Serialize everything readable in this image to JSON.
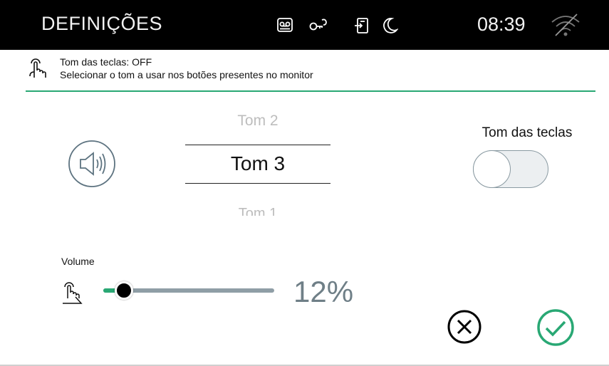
{
  "topbar": {
    "title": "DEFINIÇÕES",
    "time": "08:39",
    "icons": [
      "voicemail-icon",
      "key-icon",
      "door-phone-icon",
      "moon-icon",
      "wifi-off-icon"
    ]
  },
  "info": {
    "title": "Tom das teclas: OFF",
    "description": "Selecionar o tom a usar nos botões presentes no monitor"
  },
  "tone_picker": {
    "previous": "Tom 2",
    "current": "Tom 3",
    "next": "Tom 1"
  },
  "toggle": {
    "label": "Tom das teclas",
    "state": "off"
  },
  "volume": {
    "label": "Volume",
    "value_text": "12%",
    "fraction": 0.12
  },
  "colors": {
    "accent": "#29a874",
    "topbar_bg": "#000000",
    "slider_track": "#8f9ea6",
    "value_text": "#6f7f87"
  }
}
